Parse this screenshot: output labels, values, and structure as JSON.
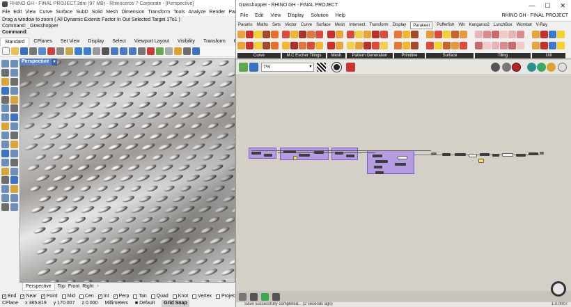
{
  "rhino": {
    "title": "RHINO GH - FINAL PROJECT.3dm (97 MB) - Rhinoceros 7 Corporate - [Perspective]",
    "menu": [
      "File",
      "Edit",
      "View",
      "Curve",
      "Surface",
      "SubD",
      "Solid",
      "Mesh",
      "Dimension",
      "Transform",
      "Tools",
      "Analyze",
      "Render",
      "Panels"
    ],
    "command_history": "Drag a window to zoom ( All  Dynamic  Extents  Factor  In  Out  Selected  Target  1To1 )",
    "command_previous": "Command: _Grasshopper",
    "command_prompt": "Command:",
    "toolbar_tabs": [
      "Standard",
      "CPlanes",
      "Set View",
      "Display",
      "Select",
      "Viewport Layout",
      "Visibility",
      "Transform",
      "Curve"
    ],
    "viewport_name": "Perspective",
    "viewport_tabs": [
      "Perspective",
      "Top",
      "Front",
      "Right"
    ],
    "add_tab_symbol": "+",
    "osnaps": [
      {
        "label": "End",
        "checked": true
      },
      {
        "label": "Near",
        "checked": true
      },
      {
        "label": "Point",
        "checked": true
      },
      {
        "label": "Mid",
        "checked": false
      },
      {
        "label": "Cen",
        "checked": false
      },
      {
        "label": "Int",
        "checked": true
      },
      {
        "label": "Perp",
        "checked": true
      },
      {
        "label": "Tan",
        "checked": false
      },
      {
        "label": "Quad",
        "checked": false
      },
      {
        "label": "Knot",
        "checked": false
      },
      {
        "label": "Vertex",
        "checked": false
      },
      {
        "label": "Project",
        "checked": false
      },
      {
        "label": "Disable",
        "checked": false
      }
    ],
    "status": {
      "cplane": "CPlane",
      "x": "x 385.819",
      "y": "y 170.007",
      "z": "z 0.000",
      "units": "Millimeters",
      "layer": "Default",
      "grid_snap": "Grid Snap"
    }
  },
  "grasshopper": {
    "title": "Grasshopper - RHINO GH - FINAL PROJECT",
    "window_buttons": {
      "minimize": "—",
      "maximize": "☐",
      "close": "✕"
    },
    "menu": [
      "File",
      "Edit",
      "View",
      "Display",
      "Solution",
      "Help"
    ],
    "document_name": "RHINO GH - FINAL PROJECT",
    "tabs": [
      "Params",
      "Maths",
      "Sets",
      "Vector",
      "Curve",
      "Surface",
      "Mesh",
      "Intersect",
      "Transform",
      "Display",
      "Parakeet",
      "Pufferfish",
      "Wb",
      "Kangaroo2",
      "LunchBox",
      "Wombat",
      "V-Ray"
    ],
    "active_tab": "Parakeet",
    "ribbon_groups": [
      "Curve",
      "M.C Escher Tilings",
      "Mesh",
      "Pattern Generation",
      "Primitive",
      "Surface",
      "Tiling",
      "Util"
    ],
    "zoom": "7%",
    "status_message": "Save successfully completed... (2 seconds ago)",
    "version": "1.0.0007",
    "colors": {
      "cluster_fill": "#a078f0",
      "canvas": "#d4d0c8",
      "ribbon_label_bg": "#2f2f2f"
    }
  }
}
